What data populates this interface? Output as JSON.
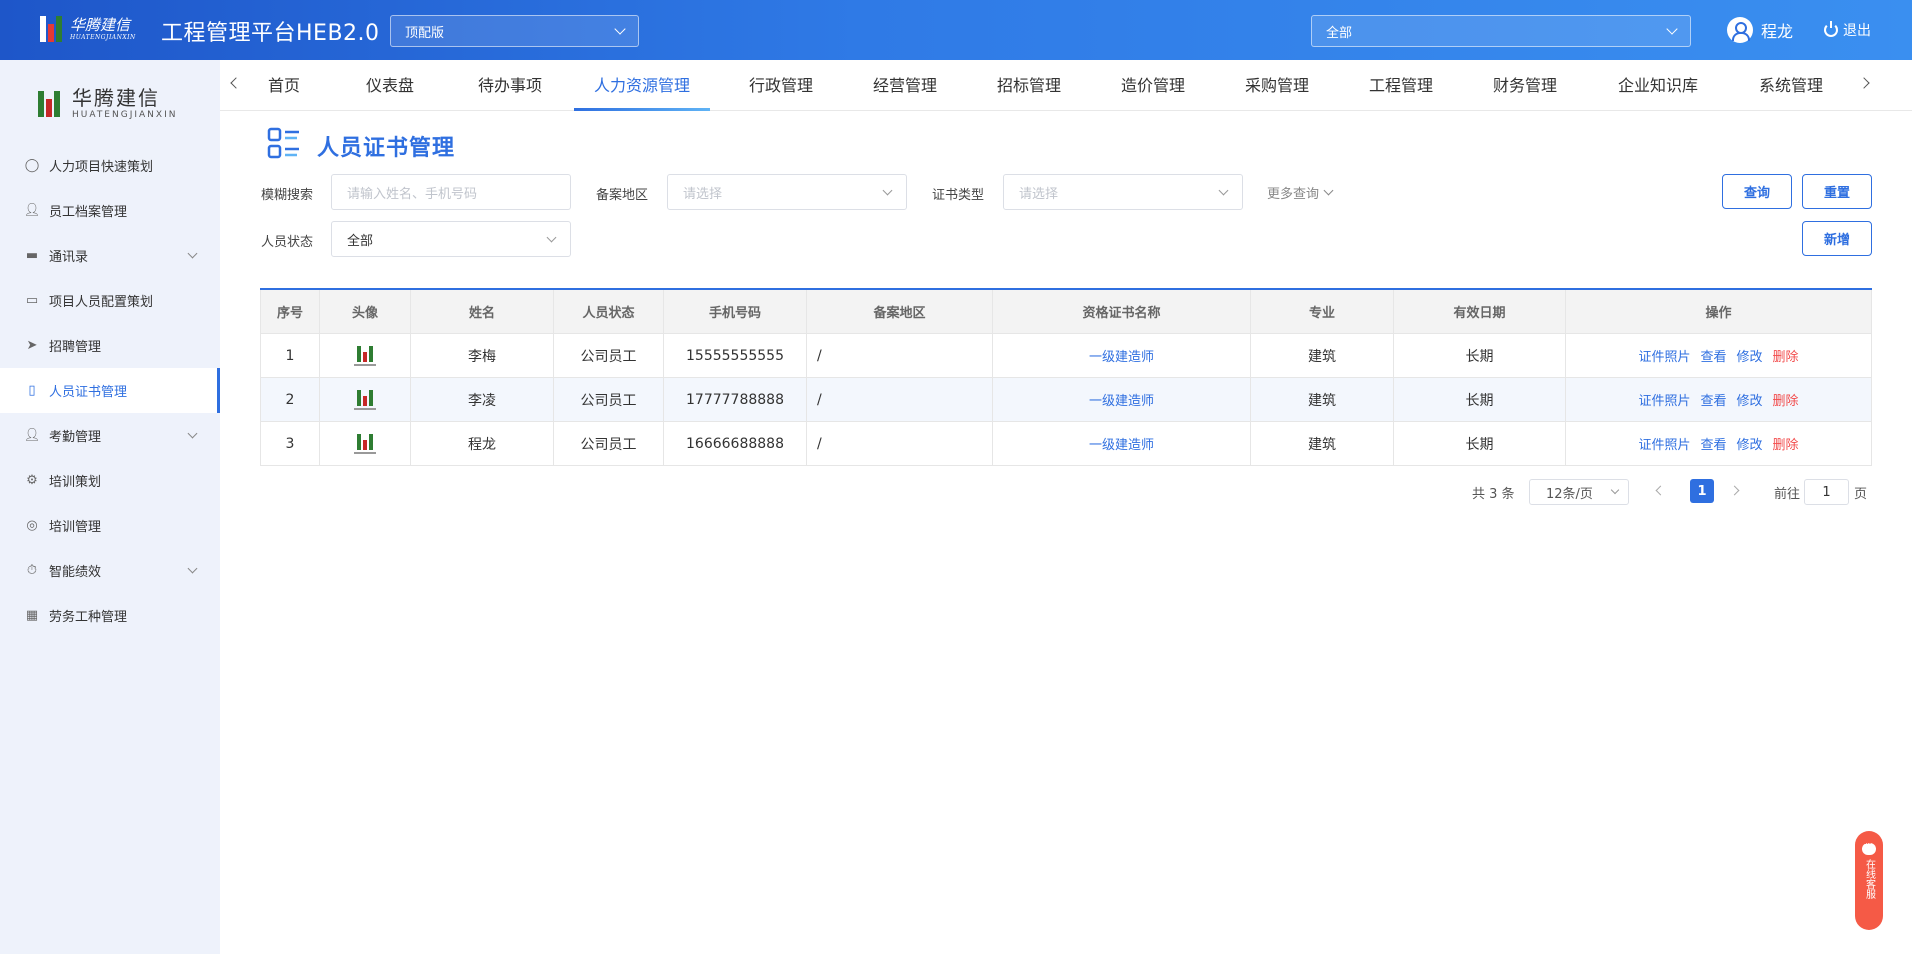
{
  "header": {
    "logo_text": "华腾建信",
    "logo_sub": "HUATENGJIANXIN",
    "app_title": "工程管理平台HEB2.0",
    "edition": "顶配版",
    "scope": "全部",
    "user_name": "程龙",
    "logout_label": "退出"
  },
  "sidebar": {
    "logo_name": "华腾建信",
    "logo_sub": "HUATENGJIANXIN",
    "items": [
      {
        "label": "人力项目快速策划",
        "icon": "check-circle-icon"
      },
      {
        "label": "员工档案管理",
        "icon": "user-icon"
      },
      {
        "label": "通讯录",
        "icon": "briefcase-icon"
      },
      {
        "label": "项目人员配置策划",
        "icon": "monitor-icon"
      },
      {
        "label": "招聘管理",
        "icon": "send-icon"
      },
      {
        "label": "人员证书管理",
        "icon": "document-icon"
      },
      {
        "label": "考勤管理",
        "icon": "user-icon"
      },
      {
        "label": "培训策划",
        "icon": "gear-circle-icon"
      },
      {
        "label": "培训管理",
        "icon": "target-icon"
      },
      {
        "label": "智能绩效",
        "icon": "stopwatch-icon"
      },
      {
        "label": "劳务工种管理",
        "icon": "grid-icon"
      }
    ]
  },
  "nav": {
    "tabs": [
      "首页",
      "仪表盘",
      "待办事项",
      "人力资源管理",
      "行政管理",
      "经营管理",
      "招标管理",
      "造价管理",
      "采购管理",
      "工程管理",
      "财务管理",
      "企业知识库",
      "系统管理"
    ]
  },
  "page": {
    "title": "人员证书管理"
  },
  "filters": {
    "fuzzy_label": "模糊搜索",
    "fuzzy_placeholder": "请输入姓名、手机号码",
    "region_label": "备案地区",
    "region_placeholder": "请选择",
    "cert_type_label": "证书类型",
    "cert_type_placeholder": "请选择",
    "more_label": "更多查询",
    "status_label": "人员状态",
    "status_value": "全部",
    "query_btn": "查询",
    "reset_btn": "重置",
    "add_btn": "新增"
  },
  "table": {
    "headers": [
      "序号",
      "头像",
      "姓名",
      "人员状态",
      "手机号码",
      "备案地区",
      "资格证书名称",
      "专业",
      "有效日期",
      "操作"
    ],
    "rows": [
      {
        "no": "1",
        "name": "李梅",
        "status": "公司员工",
        "phone": "15555555555",
        "region": "/",
        "cert": "一级建造师",
        "major": "建筑",
        "valid": "长期"
      },
      {
        "no": "2",
        "name": "李凌",
        "status": "公司员工",
        "phone": "17777788888",
        "region": "/",
        "cert": "一级建造师",
        "major": "建筑",
        "valid": "长期"
      },
      {
        "no": "3",
        "name": "程龙",
        "status": "公司员工",
        "phone": "16666688888",
        "region": "/",
        "cert": "一级建造师",
        "major": "建筑",
        "valid": "长期"
      }
    ],
    "ops": {
      "photo": "证件照片",
      "view": "查看",
      "edit": "修改",
      "delete": "删除"
    }
  },
  "pagination": {
    "total": "共 3 条",
    "page_size": "12条/页",
    "current": "1",
    "goto_label": "前往",
    "goto_value": "1",
    "page_label": "页"
  },
  "service": {
    "label": "在线客服"
  },
  "colors": {
    "primary": "#2f6fe0",
    "danger": "#f24b4b",
    "sidebar_bg": "#eef2fb",
    "service": "#f55a46"
  }
}
